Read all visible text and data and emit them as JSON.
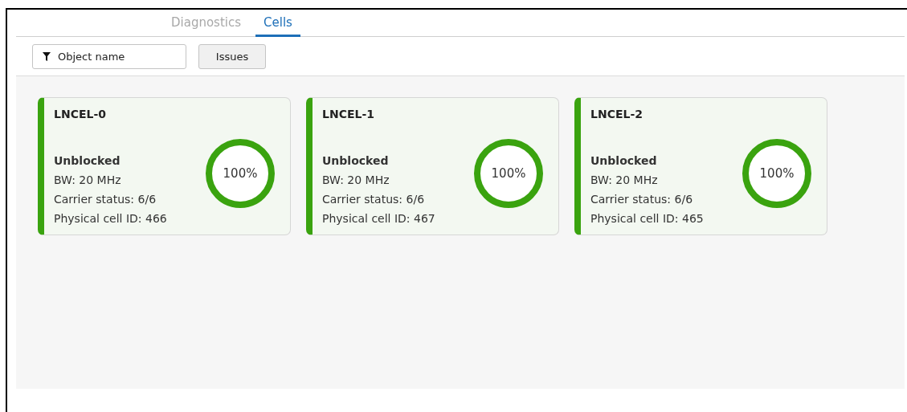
{
  "tabs": [
    {
      "label": "Diagnostics",
      "selected": false
    },
    {
      "label": "Cells",
      "selected": true
    }
  ],
  "filter": {
    "placeholder": "Object name"
  },
  "buttons": [
    "Issues"
  ],
  "cells": [
    {
      "name": "LNCEL-0",
      "status": "Unblocked",
      "bw": "BW: 20 MHz",
      "carrier": "Carrier status: 6/6",
      "pci": "Physical cell ID: 466",
      "reading": "100%",
      "color": "#3aa30f"
    },
    {
      "name": "LNCEL-1",
      "status": "Unblocked",
      "bw": "BW: 20 MHz",
      "carrier": "Carrier status: 6/6",
      "pci": "Physical cell ID: 467",
      "reading": "100%",
      "color": "#3aa30f"
    },
    {
      "name": "LNCEL-2",
      "status": "Unblocked",
      "bw": "BW: 20 MHz",
      "carrier": "Carrier status: 6/6",
      "pci": "Physical cell ID: 465",
      "reading": "100%",
      "color": "#3aa30f"
    }
  ]
}
